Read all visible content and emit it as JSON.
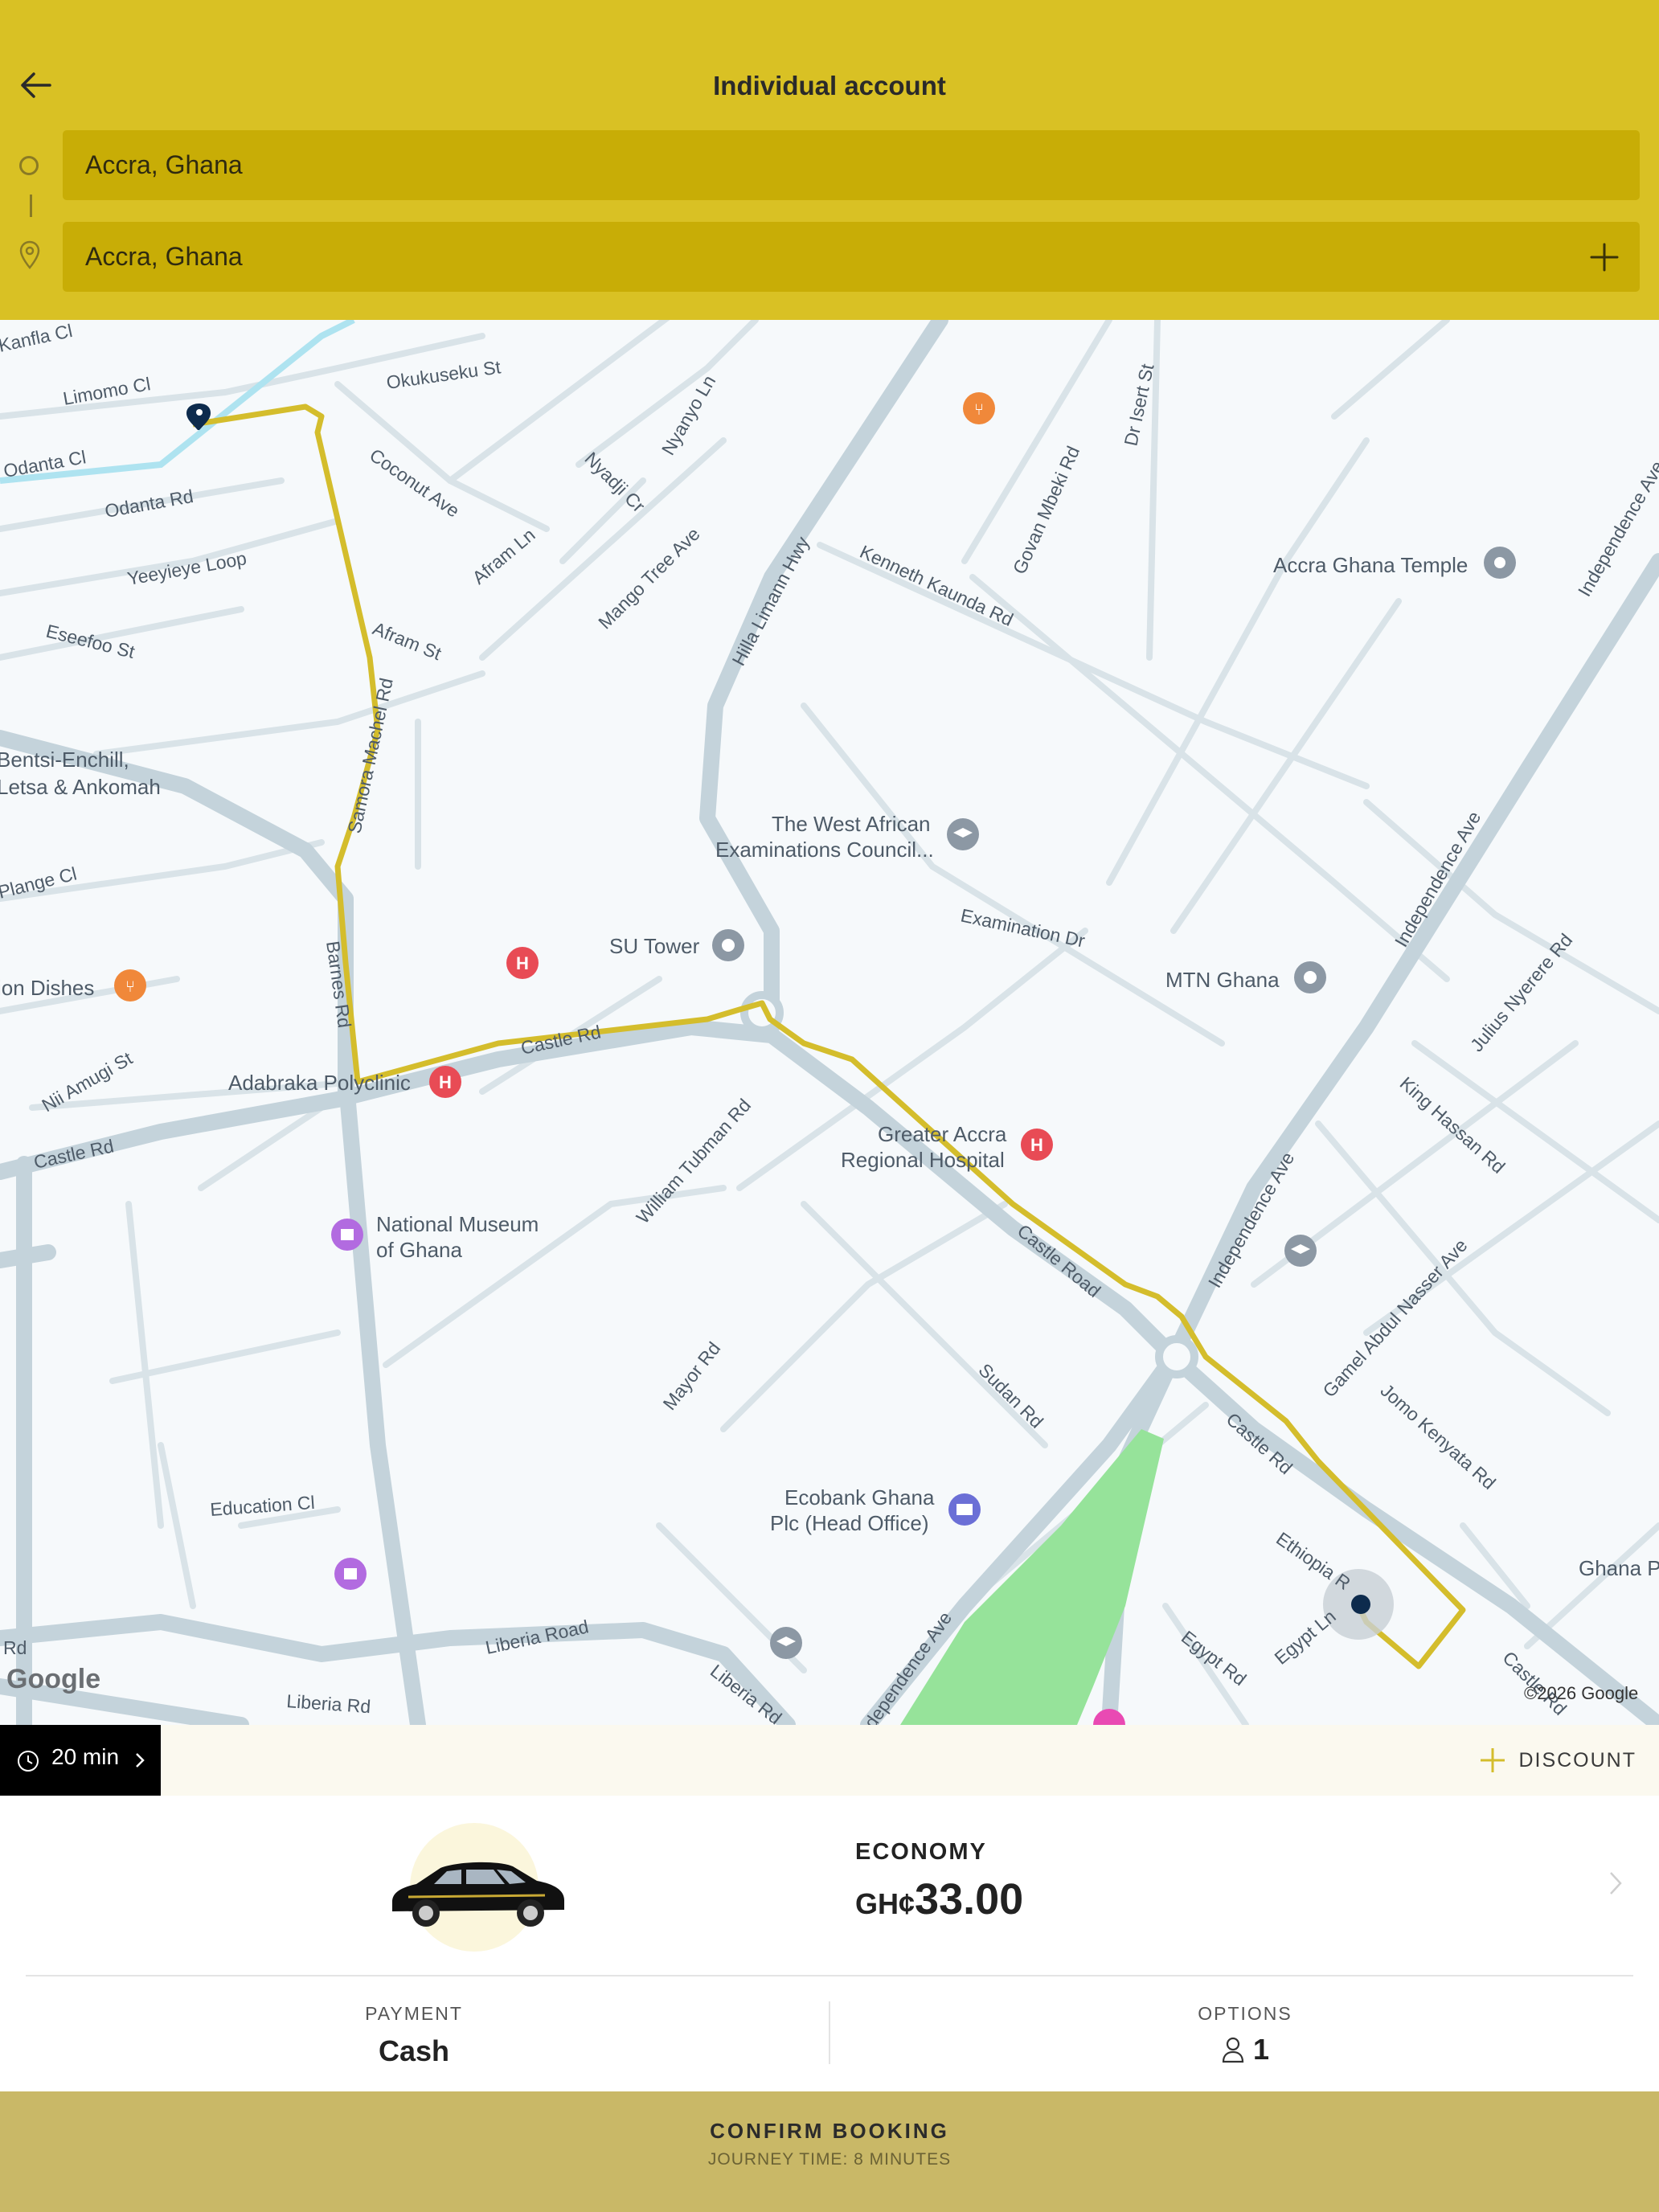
{
  "header": {
    "title": "Individual account",
    "origin_value": "Accra, Ghana",
    "destination_value": "Accra, Ghana"
  },
  "map": {
    "streets": [
      "Kanfla Cl",
      "Limomo Cl",
      "Odanta Cl",
      "Odanta Rd",
      "Okukuseku St",
      "Coconut Ave",
      "Nyadji Cr",
      "Nyanyo Ln",
      "Afram Ln",
      "Mango Tree Ave",
      "Yeeyieye Loop",
      "Eseefoo St",
      "Afram St",
      "Samora Machel Rd",
      "Hilla Limann Hwy",
      "Kenneth Kaunda Rd",
      "Govan Mbeki Rd",
      "Dr Isert St",
      "Independence Ave",
      "Plange Cl",
      "Barnes Rd",
      "Castle Rd",
      "Examination Dr",
      "Nii Amugi St",
      "William Tubman Rd",
      "Castle Road",
      "Julius Nyerere Rd",
      "King Hassan Rd",
      "Gamel Abdul Nasser Ave",
      "Jomo Kenyata Rd",
      "Mayor Rd",
      "Sudan Rd",
      "Education Cl",
      "Ethiopia Rd",
      "Egypt Rd",
      "Egypt Ln",
      "Liberia Road",
      "Liberia Rd",
      "Rd",
      "Castle Rd"
    ],
    "places": [
      {
        "name": "Accra Ghana Temple",
        "icon": "temple-icon"
      },
      {
        "name": "The West African Examinations Council...",
        "icon": "education-icon"
      },
      {
        "name": "SU Tower",
        "icon": "landmark-icon"
      },
      {
        "name": "MTN Ghana",
        "icon": "landmark-icon"
      },
      {
        "name": "Adabraka Polyclinic",
        "icon": "hospital-icon"
      },
      {
        "name": "Greater Accra Regional Hospital",
        "icon": "hospital-icon"
      },
      {
        "name": "National Museum of Ghana",
        "icon": "museum-icon"
      },
      {
        "name": "Ecobank Ghana Plc (Head Office)",
        "icon": "bank-icon"
      },
      {
        "name": "Bentsi-Enchill, Letsa & Ankomah",
        "icon": ""
      },
      {
        "name": "Ghana P",
        "icon": ""
      },
      {
        "name": "ion Dishes",
        "icon": "restaurant-icon"
      }
    ],
    "google_logo": "Google",
    "copyright": "©2026 Google"
  },
  "trip": {
    "eta": "20 min",
    "discount_label": "DISCOUNT"
  },
  "vehicle": {
    "class": "ECONOMY",
    "currency": "GH¢",
    "price": "33.00"
  },
  "payment": {
    "label": "PAYMENT",
    "value": "Cash"
  },
  "options": {
    "label": "OPTIONS",
    "passengers": "1"
  },
  "confirm": {
    "label": "CONFIRM BOOKING",
    "journey_time": "JOURNEY TIME: 8 MINUTES"
  },
  "colors": {
    "header_bg": "#d9c124",
    "field_bg": "#c8ad06",
    "route": "#d4bd2c",
    "confirm_bg": "#c9b867",
    "park": "#96e39a"
  }
}
